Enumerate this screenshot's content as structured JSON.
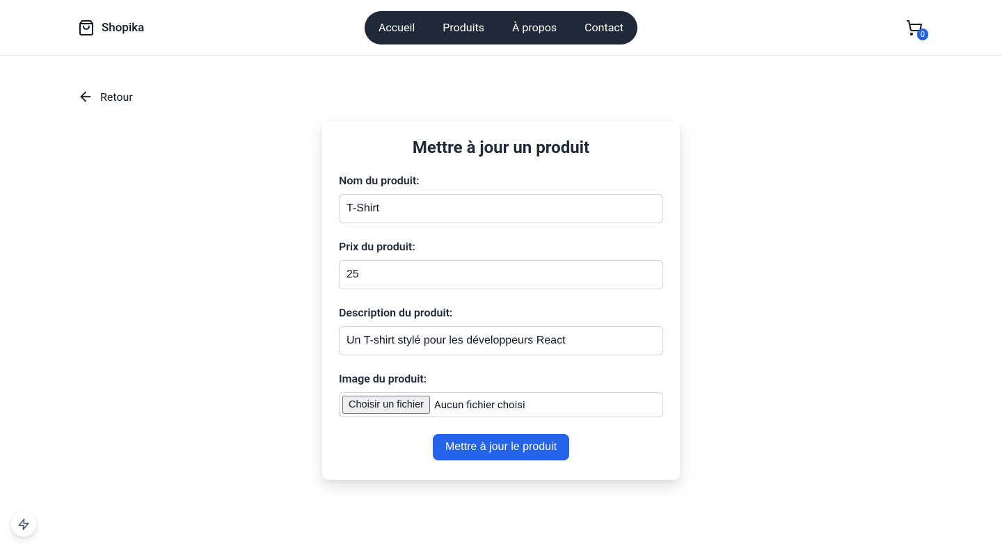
{
  "header": {
    "brand": "Shopika",
    "nav": [
      "Accueil",
      "Produits",
      "À propos",
      "Contact"
    ],
    "cart_count": "0"
  },
  "back_label": "Retour",
  "form": {
    "title": "Mettre à jour un produit",
    "name_label": "Nom du produit:",
    "name_value": "T-Shirt",
    "price_label": "Prix du produit:",
    "price_value": "25",
    "desc_label": "Description du produit:",
    "desc_value": "Un T-shirt stylé pour les développeurs React",
    "image_label": "Image du produit:",
    "file_button": "Choisir un fichier",
    "file_status": "Aucun fichier choisi",
    "submit_label": "Mettre à jour le produit"
  }
}
